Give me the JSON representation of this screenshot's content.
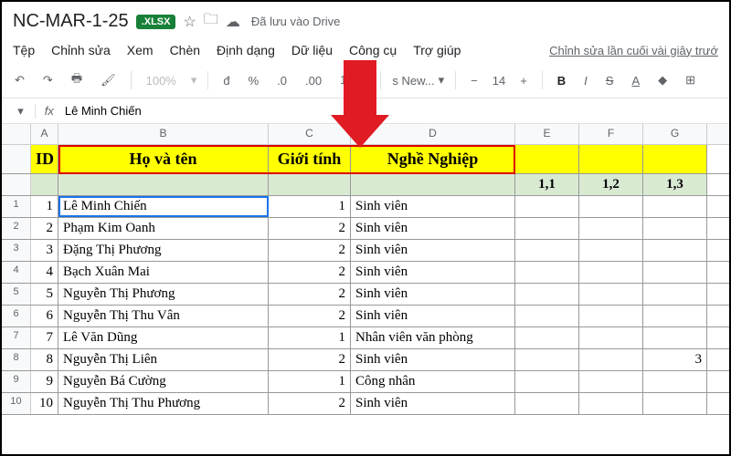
{
  "title": "NC-MAR-1-25",
  "badge": ".XLSX",
  "drive_status": "Đã lưu vào Drive",
  "menu": {
    "file": "Tệp",
    "edit": "Chỉnh sửa",
    "view": "Xem",
    "insert": "Chèn",
    "format": "Định dạng",
    "data": "Dữ liệu",
    "tools": "Công cụ",
    "help": "Trợ giúp",
    "last_edit": "Chỉnh sửa lần cuối vài giây trướ"
  },
  "toolbar": {
    "zoom": "100%",
    "currency": "đ",
    "percent": "%",
    "dec_dec": ".0",
    "dec_inc": ".00",
    "num_fmt": "123",
    "font": "s New...",
    "size": "14"
  },
  "formula": {
    "fx": "fx",
    "value": "Lê Minh Chiến"
  },
  "cols": [
    "A",
    "B",
    "C",
    "D",
    "E",
    "F",
    "G"
  ],
  "headers": {
    "id": "ID",
    "name": "Họ và tên",
    "gender": "Giới tính",
    "job": "Nghề Nghiệp"
  },
  "subheaders": {
    "e": "1,1",
    "f": "1,2",
    "g": "1,3"
  },
  "rows": [
    {
      "rn": "1",
      "id": "1",
      "name": "Lê Minh Chiến",
      "gender": "1",
      "job": "Sinh viên",
      "e": "",
      "f": "",
      "g": ""
    },
    {
      "rn": "2",
      "id": "2",
      "name": "Phạm Kim Oanh",
      "gender": "2",
      "job": "Sinh viên",
      "e": "",
      "f": "",
      "g": ""
    },
    {
      "rn": "3",
      "id": "3",
      "name": "Đặng Thị Phương",
      "gender": "2",
      "job": "Sinh viên",
      "e": "",
      "f": "",
      "g": ""
    },
    {
      "rn": "4",
      "id": "4",
      "name": "Bạch Xuân Mai",
      "gender": "2",
      "job": "Sinh viên",
      "e": "",
      "f": "",
      "g": ""
    },
    {
      "rn": "5",
      "id": "5",
      "name": "Nguyễn Thị Phương",
      "gender": "2",
      "job": "Sinh viên",
      "e": "",
      "f": "",
      "g": ""
    },
    {
      "rn": "6",
      "id": "6",
      "name": "Nguyễn Thị Thu Vân",
      "gender": "2",
      "job": "Sinh viên",
      "e": "",
      "f": "",
      "g": ""
    },
    {
      "rn": "7",
      "id": "7",
      "name": "Lê Văn Dũng",
      "gender": "1",
      "job": "Nhân viên văn phòng",
      "e": "",
      "f": "",
      "g": ""
    },
    {
      "rn": "8",
      "id": "8",
      "name": "Nguyễn Thị Liên",
      "gender": "2",
      "job": "Sinh viên",
      "e": "",
      "f": "",
      "g": "3"
    },
    {
      "rn": "9",
      "id": "9",
      "name": "Nguyễn Bá Cường",
      "gender": "1",
      "job": "Công nhân",
      "e": "",
      "f": "",
      "g": ""
    },
    {
      "rn": "10",
      "id": "10",
      "name": "Nguyễn Thị Thu Phương",
      "gender": "2",
      "job": "Sinh viên",
      "e": "",
      "f": "",
      "g": ""
    }
  ]
}
